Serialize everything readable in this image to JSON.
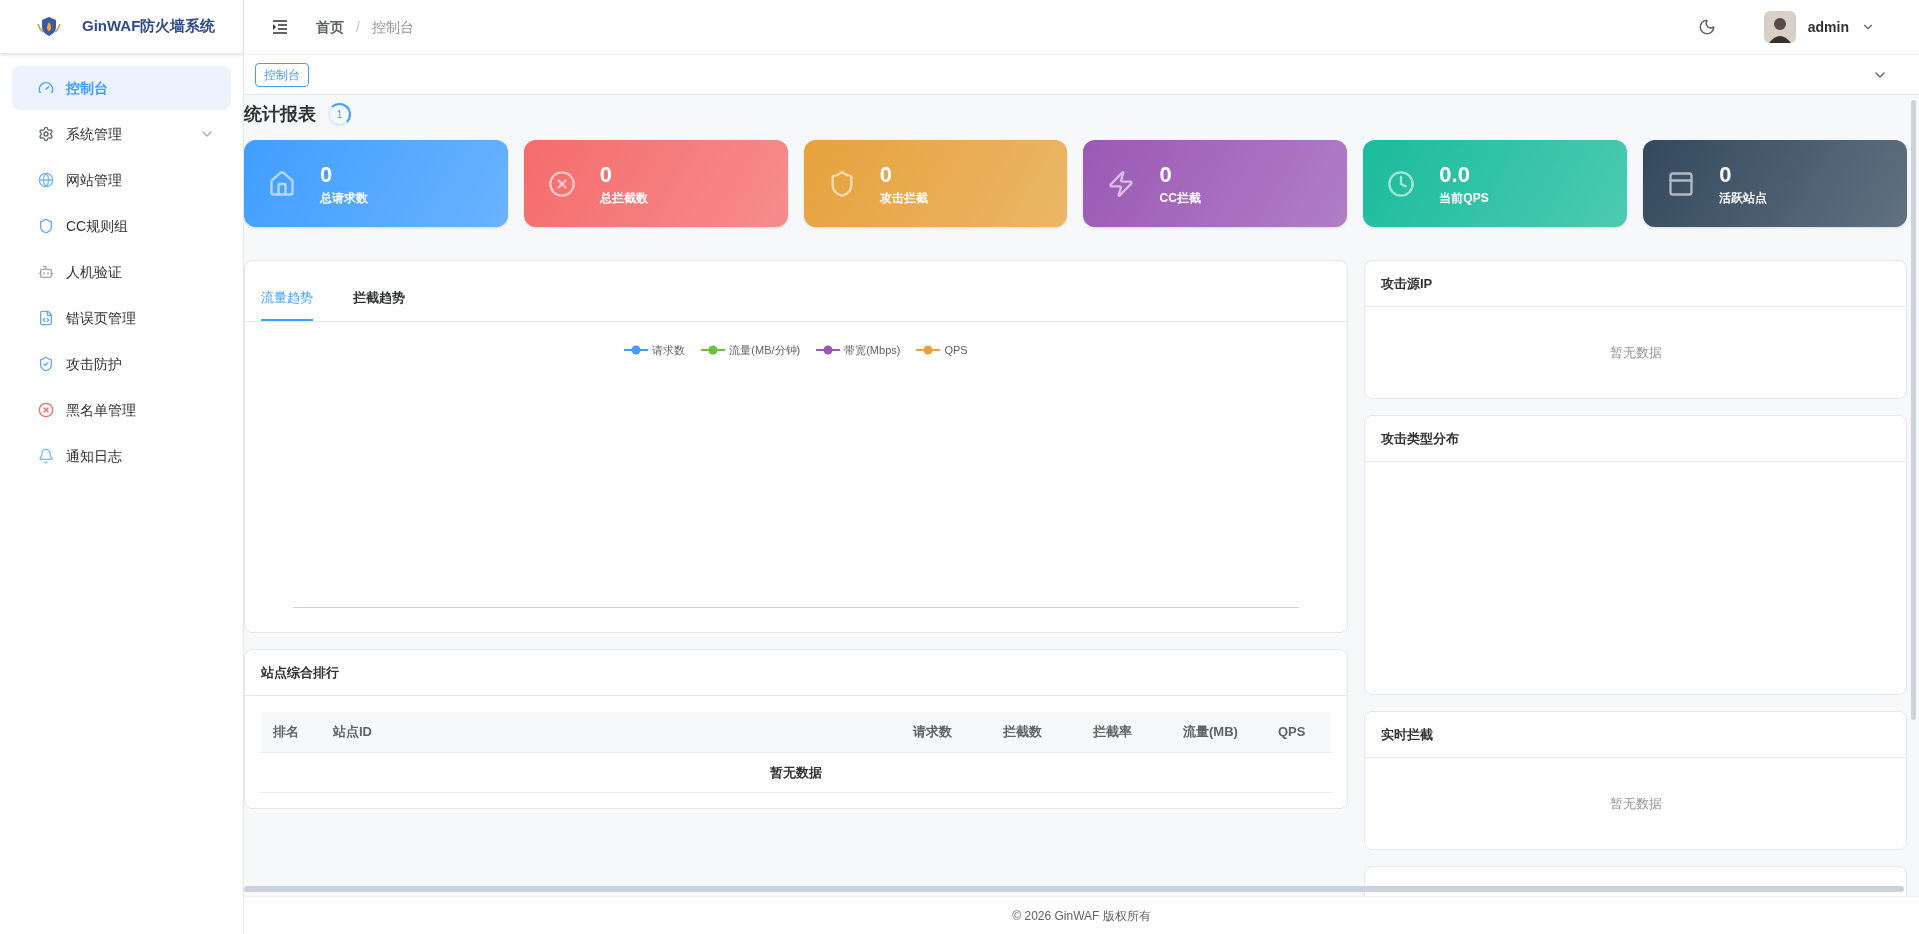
{
  "brand": {
    "title": "GinWAF防火墙系统"
  },
  "sidebar": {
    "items": [
      {
        "label": "控制台",
        "kind": "link",
        "selected": true
      },
      {
        "label": "系统管理",
        "kind": "group",
        "selected": false
      },
      {
        "label": "网站管理",
        "kind": "link",
        "selected": false
      },
      {
        "label": "CC规则组",
        "kind": "link",
        "selected": false
      },
      {
        "label": "人机验证",
        "kind": "link",
        "selected": false
      },
      {
        "label": "错误页管理",
        "kind": "link",
        "selected": false
      },
      {
        "label": "攻击防护",
        "kind": "link",
        "selected": false
      },
      {
        "label": "黑名单管理",
        "kind": "link",
        "selected": false
      },
      {
        "label": "通知日志",
        "kind": "link",
        "selected": false
      }
    ]
  },
  "header": {
    "breadcrumb": [
      "首页",
      "控制台"
    ],
    "separator": "/",
    "user": "admin"
  },
  "tags": [
    {
      "label": "控制台",
      "selected": true
    }
  ],
  "page": {
    "title": "统计报表",
    "badge": "1"
  },
  "stats": [
    {
      "value": "0",
      "label": "总请求数",
      "color": "#409eff"
    },
    {
      "value": "0",
      "label": "总拦截数",
      "color": "#f56c6c"
    },
    {
      "value": "0",
      "label": "攻击拦截",
      "color": "#e6a23c"
    },
    {
      "value": "0",
      "label": "CC拦截",
      "color": "#9b59b6"
    },
    {
      "value": "0.0",
      "label": "当前QPS",
      "color": "#1abc9c"
    },
    {
      "value": "0",
      "label": "活跃站点",
      "color": "#34495e"
    }
  ],
  "trend": {
    "tabs": [
      {
        "label": "流量趋势",
        "selected": true
      },
      {
        "label": "拦截趋势",
        "selected": false
      }
    ],
    "legend": [
      {
        "label": "请求数",
        "color": "#409eff"
      },
      {
        "label": "流量(MB/分钟)",
        "color": "#67c23a"
      },
      {
        "label": "带宽(Mbps)",
        "color": "#9b59b6"
      },
      {
        "label": "QPS",
        "color": "#e6a23c"
      }
    ]
  },
  "ranking": {
    "title": "站点综合排行",
    "columns": [
      "排名",
      "站点ID",
      "请求数",
      "拦截数",
      "拦截率",
      "流量(MB)",
      "QPS"
    ],
    "empty": "暂无数据"
  },
  "side_cards": [
    {
      "title": "攻击源IP",
      "empty": "暂无数据",
      "kind": "short"
    },
    {
      "title": "攻击类型分布",
      "kind": "tall"
    },
    {
      "title": "实时拦截",
      "empty": "暂无数据",
      "kind": "short"
    },
    {
      "kind": "cut"
    }
  ],
  "footer": "© 2026 GinWAF 版权所有"
}
